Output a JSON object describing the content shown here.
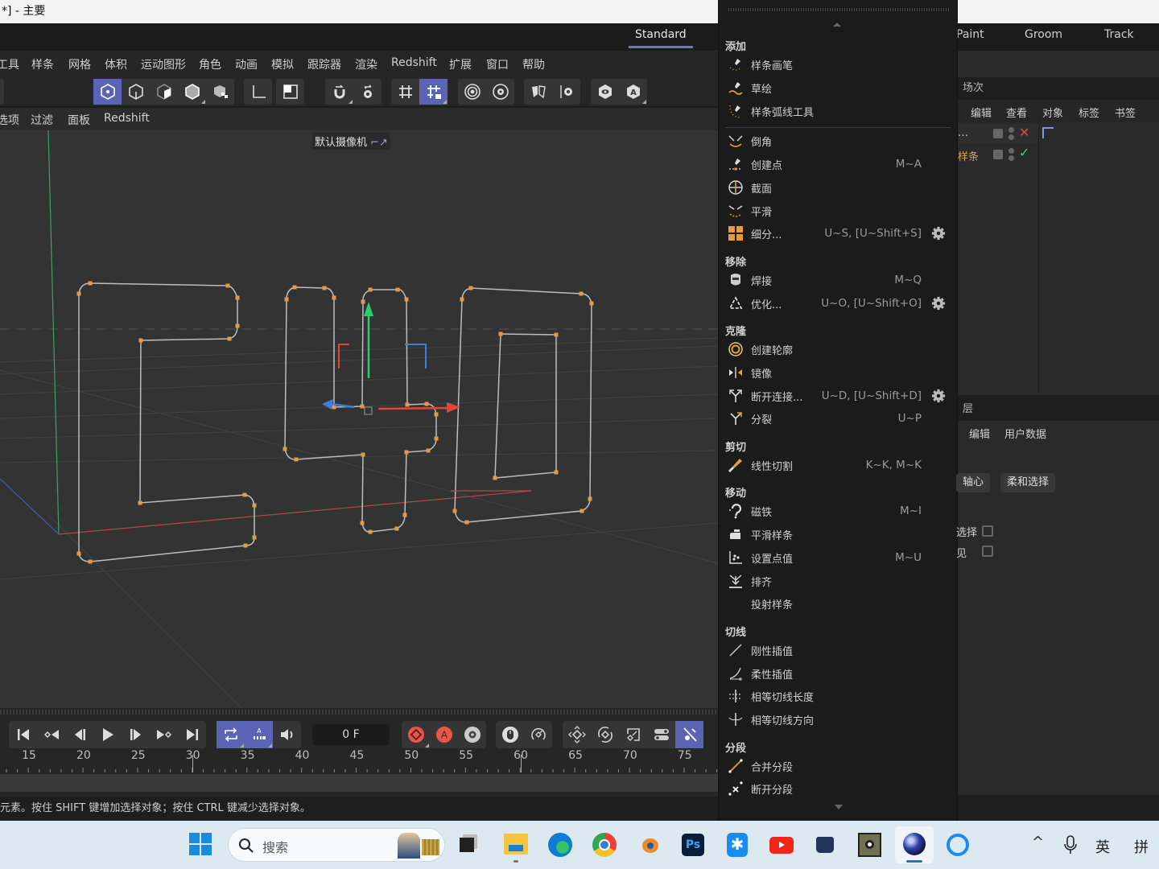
{
  "window": {
    "title": "*] - 主要"
  },
  "layout_tabs": {
    "standard": "Standard",
    "paint": "Paint",
    "groom": "Groom",
    "track": "Track"
  },
  "menubar": [
    "工具",
    "样条",
    "网格",
    "体积",
    "运动图形",
    "角色",
    "动画",
    "模拟",
    "跟踪器",
    "渲染",
    "Redshift",
    "扩展",
    "窗口",
    "帮助"
  ],
  "viewport_menu": [
    "选项",
    "过滤",
    "面板",
    "Redshift"
  ],
  "viewport": {
    "camera_label": "默认摄像机",
    "camera_icon": "camera-link-icon",
    "axis_colors": {
      "x": "#e0453a",
      "y": "#2ecc71",
      "z": "#3d7de0"
    },
    "spline_point_color": "#e09a4a",
    "spline_line_color": "#bdbdbd"
  },
  "toolbar": {
    "groups": [
      [
        "model-mode-icon",
        "points-mode-icon",
        "edges-mode-icon",
        "polygons-mode-icon",
        "uvw-mode-icon"
      ],
      [
        "axis-icon"
      ],
      [
        "solo-icon"
      ],
      [
        "snap-magnet-icon",
        "snap-settings-icon"
      ],
      [
        "workplane-icon",
        "locked-workplane-icon"
      ],
      [
        "render-view-icon",
        "render-settings-icon"
      ],
      [
        "symmetry-icon",
        "symmetry-settings-icon"
      ],
      [
        "view-icon",
        "auto-icon"
      ]
    ],
    "active": [
      "model-mode-icon",
      "locked-workplane-icon"
    ]
  },
  "popup": {
    "sections": [
      {
        "title": "添加",
        "items": [
          {
            "icon": "spline-pen-icon",
            "label": "样条画笔",
            "shortcut": ""
          },
          {
            "icon": "sketch-icon",
            "label": "草绘",
            "shortcut": ""
          },
          {
            "icon": "spline-arc-icon",
            "label": "样条弧线工具",
            "shortcut": ""
          }
        ]
      },
      {
        "title": "",
        "items": [
          {
            "icon": "chamfer-icon",
            "label": "倒角",
            "shortcut": ""
          },
          {
            "icon": "create-point-icon",
            "label": "创建点",
            "shortcut": "M~A"
          },
          {
            "icon": "section-icon",
            "label": "截面",
            "shortcut": ""
          },
          {
            "icon": "smooth-icon",
            "label": "平滑",
            "shortcut": ""
          },
          {
            "icon": "subdivide-icon",
            "label": "细分...",
            "shortcut": "U~S, [U~Shift+S]",
            "settings": true
          }
        ]
      },
      {
        "title": "移除",
        "items": [
          {
            "icon": "weld-icon",
            "label": "焊接",
            "shortcut": "M~Q"
          },
          {
            "icon": "optimize-icon",
            "label": "优化...",
            "shortcut": "U~O, [U~Shift+O]",
            "settings": true
          }
        ]
      },
      {
        "title": "克隆",
        "items": [
          {
            "icon": "create-outline-icon",
            "label": "创建轮廓",
            "shortcut": ""
          },
          {
            "icon": "mirror-icon",
            "label": "镜像",
            "shortcut": ""
          },
          {
            "icon": "disconnect-icon",
            "label": "断开连接...",
            "shortcut": "U~D, [U~Shift+D]",
            "settings": true
          },
          {
            "icon": "split-icon",
            "label": "分裂",
            "shortcut": "U~P"
          }
        ]
      },
      {
        "title": "剪切",
        "items": [
          {
            "icon": "knife-icon",
            "label": "线性切割",
            "shortcut": "K~K, M~K"
          }
        ]
      },
      {
        "title": "移动",
        "items": [
          {
            "icon": "magnet-icon",
            "label": "磁铁",
            "shortcut": "M~I"
          },
          {
            "icon": "smooth-spline-icon",
            "label": "平滑样条",
            "shortcut": ""
          },
          {
            "icon": "set-point-value-icon",
            "label": "设置点值",
            "shortcut": "M~U"
          },
          {
            "icon": "align-icon",
            "label": "排齐",
            "shortcut": ""
          },
          {
            "icon": "",
            "label": "投射样条",
            "shortcut": ""
          }
        ]
      },
      {
        "title": "切线",
        "items": [
          {
            "icon": "hard-interpolation-icon",
            "label": "刚性插值",
            "shortcut": ""
          },
          {
            "icon": "soft-interpolation-icon",
            "label": "柔性插值",
            "shortcut": ""
          },
          {
            "icon": "equal-tangent-length-icon",
            "label": "相等切线长度",
            "shortcut": ""
          },
          {
            "icon": "equal-tangent-direction-icon",
            "label": "相等切线方向",
            "shortcut": ""
          }
        ]
      },
      {
        "title": "分段",
        "items": [
          {
            "icon": "join-segment-icon",
            "label": "合并分段",
            "shortcut": ""
          },
          {
            "icon": "break-segment-icon",
            "label": "断开分段",
            "shortcut": ""
          }
        ]
      }
    ]
  },
  "right_panel": {
    "objects_header": "场次",
    "objects_menu": [
      "编辑",
      "查看",
      "对象",
      "标签",
      "书签"
    ],
    "objects": [
      {
        "name": "…",
        "status": "disabled",
        "color": "#cfcfcf"
      },
      {
        "name": "样条",
        "status": "enabled",
        "color": "#e0a040"
      }
    ],
    "attributes_header": "层",
    "attributes_menu": [
      "编辑",
      "用户数据"
    ],
    "attribute_buttons": [
      "轴心",
      "柔和选择"
    ],
    "checkboxes": [
      {
        "label": "选择",
        "checked": false
      },
      {
        "label": "见",
        "checked": false
      }
    ]
  },
  "timeline": {
    "current_frame": "0 F",
    "ruler_labels": [
      "15",
      "20",
      "25",
      "30",
      "35",
      "40",
      "45",
      "50",
      "55",
      "60",
      "65",
      "70",
      "75"
    ],
    "playback_buttons": [
      "go-to-start-icon",
      "prev-key-icon",
      "prev-frame-icon",
      "play-icon",
      "next-frame-icon",
      "next-key-icon",
      "go-to-end-icon"
    ],
    "mode_buttons": [
      "loop-icon",
      "autokey-mode-icon",
      "sound-icon"
    ],
    "key_buttons": [
      "record-key-icon",
      "autokey-icon",
      "key-settings-icon"
    ],
    "mouse_buttons": [
      "mouse-icon",
      "speed-icon"
    ],
    "extra_buttons": [
      "key-position-icon",
      "key-rotation-icon",
      "key-scale-icon",
      "key-param-icon",
      "key-pla-icon"
    ]
  },
  "statusbar": {
    "text": "元素。按住 SHIFT 键增加选择对象；按住 CTRL 键减少选择对象。"
  },
  "taskbar": {
    "search_placeholder": "搜索",
    "apps": [
      "start",
      "search",
      "task-view",
      "file-explorer",
      "edge",
      "chrome",
      "blender",
      "photoshop",
      "app-asterisk",
      "youtube",
      "app-cat",
      "app-pixel",
      "cinema4d",
      "app-chat"
    ],
    "tray": {
      "chevron": "^",
      "mic": "mic",
      "lang": "英",
      "ime": "拼"
    }
  }
}
